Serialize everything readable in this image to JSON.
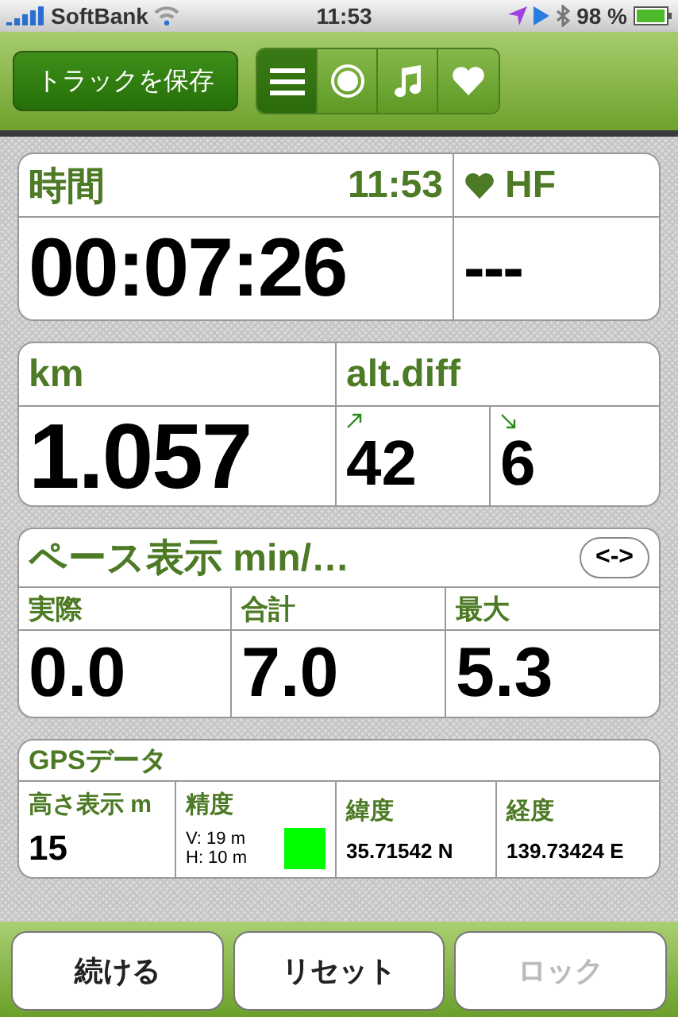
{
  "status_bar": {
    "carrier": "SoftBank",
    "time": "11:53",
    "battery": "98 %"
  },
  "toolbar": {
    "save_button": "トラックを保存",
    "segments": [
      {
        "kind": "list",
        "selected": true
      },
      {
        "kind": "record",
        "selected": false
      },
      {
        "kind": "music",
        "selected": false
      },
      {
        "kind": "heart",
        "selected": false
      }
    ]
  },
  "time_panel": {
    "label": "時間",
    "clock": "11:53",
    "value": "00:07:26",
    "hr_label": "HF",
    "hr_value": "---"
  },
  "distance_panel": {
    "label": "km",
    "value": "1.057",
    "alt_label": "alt.diff",
    "ascent": "42",
    "descent": "6"
  },
  "pace_panel": {
    "title": "ペース表示 min/…",
    "toggle": "<->",
    "columns": [
      {
        "label": "実際",
        "value": "0.0"
      },
      {
        "label": "合計",
        "value": "7.0"
      },
      {
        "label": "最大",
        "value": "5.3"
      }
    ]
  },
  "gps_panel": {
    "title": "GPSデータ",
    "altitude_label": "高さ表示 m",
    "altitude": "15",
    "accuracy_label": "精度",
    "vertical": "V: 19 m",
    "horizontal": "H: 10 m",
    "accuracy_indicator": {
      "color": "#00ff00"
    },
    "lat_label": "緯度",
    "latitude": "35.71542 N",
    "lon_label": "経度",
    "longitude": "139.73424 E"
  },
  "bottom_buttons": [
    {
      "label": "続ける",
      "disabled": false
    },
    {
      "label": "リセット",
      "disabled": false
    },
    {
      "label": "ロック",
      "disabled": true
    }
  ]
}
